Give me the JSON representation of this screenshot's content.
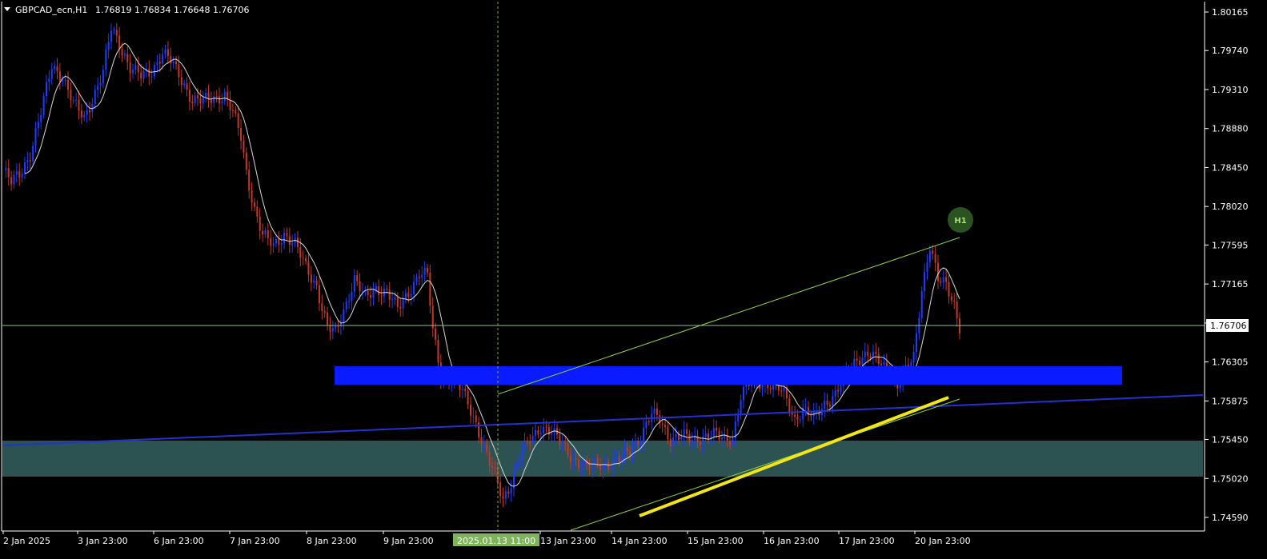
{
  "header": {
    "symbol": "GBPCAD_ecn,H1",
    "ohlc": "1.76819 1.76834 1.76648 1.76706",
    "marker": "H1"
  },
  "crosshair": {
    "time_label": "2025.01.13 11:00"
  },
  "chart_data": {
    "type": "candlestick",
    "timeframe": "H1",
    "y_ticks": [
      "1.80165",
      "1.79740",
      "1.79310",
      "1.78880",
      "1.78450",
      "1.78020",
      "1.77595",
      "1.77165",
      "1.76735",
      "1.76305",
      "1.75875",
      "1.75450",
      "1.75020",
      "1.74590"
    ],
    "x_ticks": [
      "2 Jan 2025",
      "3 Jan 23:00",
      "6 Jan 23:00",
      "7 Jan 23:00",
      "8 Jan 23:00",
      "9 Jan 23:00",
      "13 Jan 23:00",
      "14 Jan 23:00",
      "15 Jan 23:00",
      "16 Jan 23:00",
      "17 Jan 23:00",
      "20 Jan 23:00"
    ],
    "current_price": "1.76706",
    "ylim": [
      1.7444,
      1.8028
    ],
    "colors": {
      "bull": "#1e3cff",
      "bear": "#c0392b",
      "ma": "#d8d8d8",
      "zone_blue": "#0a1cff",
      "zone_teal": "#2d5252",
      "channel": "#8fd43a",
      "trend_blue": "#2233cc",
      "trend_yellow": "#f2e615",
      "hline": "#8fbf8f",
      "crosshair": "#7fa84a",
      "marker_fill": "#2b5221",
      "marker_text": "#a8e07a"
    },
    "path": [
      [
        0,
        1.7842
      ],
      [
        3,
        1.7828
      ],
      [
        6,
        1.7838
      ],
      [
        10,
        1.786
      ],
      [
        14,
        1.7905
      ],
      [
        18,
        1.7958
      ],
      [
        22,
        1.7945
      ],
      [
        26,
        1.7915
      ],
      [
        30,
        1.79
      ],
      [
        34,
        1.7928
      ],
      [
        37,
        1.795
      ],
      [
        40,
        1.7998
      ],
      [
        43,
        1.7982
      ],
      [
        47,
        1.7955
      ],
      [
        51,
        1.7945
      ],
      [
        55,
        1.7952
      ],
      [
        59,
        1.7972
      ],
      [
        62,
        1.7962
      ],
      [
        66,
        1.7942
      ],
      [
        70,
        1.792
      ],
      [
        74,
        1.7918
      ],
      [
        78,
        1.7922
      ],
      [
        82,
        1.7925
      ],
      [
        85,
        1.7905
      ],
      [
        88,
        1.7878
      ],
      [
        90,
        1.784
      ],
      [
        93,
        1.78
      ],
      [
        96,
        1.777
      ],
      [
        100,
        1.7758
      ],
      [
        104,
        1.7772
      ],
      [
        108,
        1.776
      ],
      [
        112,
        1.7735
      ],
      [
        116,
        1.7715
      ],
      [
        118,
        1.769
      ],
      [
        120,
        1.7668
      ],
      [
        123,
        1.7662
      ],
      [
        126,
        1.7688
      ],
      [
        130,
        1.7722
      ],
      [
        134,
        1.77
      ],
      [
        138,
        1.7712
      ],
      [
        142,
        1.7708
      ],
      [
        146,
        1.7688
      ],
      [
        150,
        1.7708
      ],
      [
        154,
        1.7728
      ],
      [
        157,
        1.7725
      ],
      [
        159,
        1.7665
      ],
      [
        162,
        1.7618
      ],
      [
        166,
        1.7612
      ],
      [
        170,
        1.7598
      ],
      [
        174,
        1.7572
      ],
      [
        177,
        1.7545
      ],
      [
        180,
        1.7518
      ],
      [
        182,
        1.7505
      ],
      [
        185,
        1.748
      ],
      [
        188,
        1.7498
      ],
      [
        191,
        1.7525
      ],
      [
        195,
        1.7545
      ],
      [
        199,
        1.756
      ],
      [
        203,
        1.7552
      ],
      [
        207,
        1.754
      ],
      [
        210,
        1.7528
      ],
      [
        213,
        1.7518
      ],
      [
        216,
        1.7512
      ],
      [
        220,
        1.752
      ],
      [
        224,
        1.7518
      ],
      [
        228,
        1.7522
      ],
      [
        232,
        1.7535
      ],
      [
        236,
        1.7548
      ],
      [
        240,
        1.7572
      ],
      [
        243,
        1.7568
      ],
      [
        247,
        1.7545
      ],
      [
        251,
        1.7548
      ],
      [
        255,
        1.7545
      ],
      [
        259,
        1.7548
      ],
      [
        263,
        1.755
      ],
      [
        267,
        1.7545
      ],
      [
        270,
        1.7548
      ],
      [
        273,
        1.7592
      ],
      [
        277,
        1.761
      ],
      [
        281,
        1.7608
      ],
      [
        285,
        1.7605
      ],
      [
        289,
        1.7595
      ],
      [
        293,
        1.7568
      ],
      [
        296,
        1.7578
      ],
      [
        300,
        1.7568
      ],
      [
        304,
        1.7585
      ],
      [
        308,
        1.7595
      ],
      [
        312,
        1.7615
      ],
      [
        316,
        1.7635
      ],
      [
        320,
        1.764
      ],
      [
        324,
        1.763
      ],
      [
        328,
        1.762
      ],
      [
        331,
        1.7605
      ],
      [
        334,
        1.762
      ],
      [
        337,
        1.7635
      ],
      [
        340,
        1.7712
      ],
      [
        343,
        1.776
      ],
      [
        346,
        1.772
      ],
      [
        349,
        1.7715
      ],
      [
        352,
        1.7695
      ],
      [
        354,
        1.767
      ]
    ]
  }
}
